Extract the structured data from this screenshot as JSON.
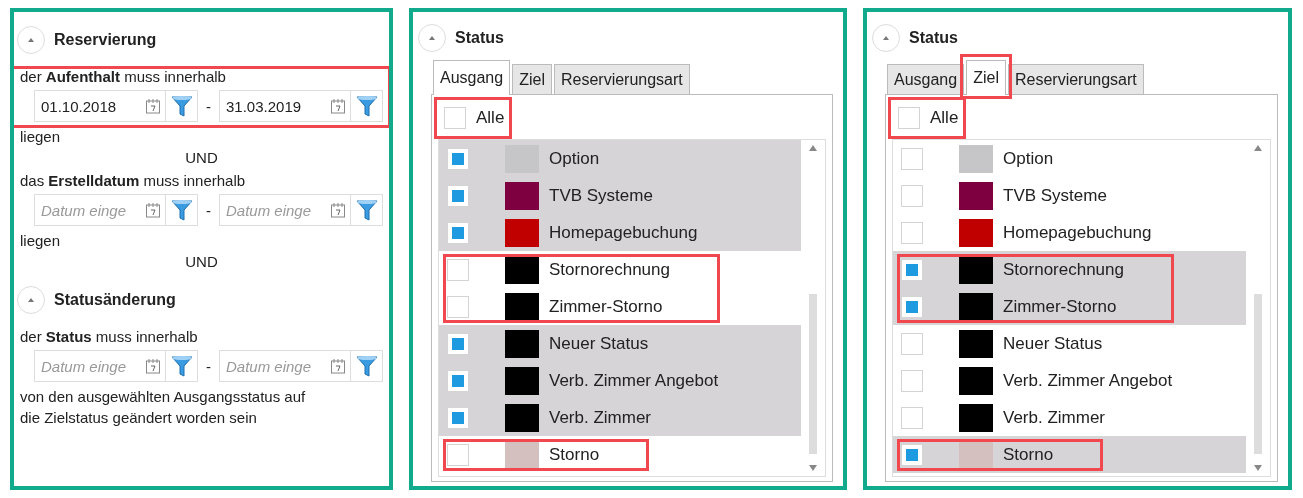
{
  "panels": [
    {
      "kind": "date_filters",
      "sections": [
        {
          "title": "Reservierung",
          "expanded": true,
          "blocks": [
            {
              "kind": "range",
              "label": "der **Aufenthalt** muss innerhalb",
              "from": {
                "value": "01.10.2018"
              },
              "separator": "-",
              "to": {
                "value": "31.03.2019"
              },
              "highlighted": true
            },
            {
              "kind": "text",
              "text": "liegen"
            },
            {
              "kind": "connector",
              "text": "UND"
            },
            {
              "kind": "range",
              "label": "das **Erstelldatum** muss innerhalb",
              "from": {
                "placeholder": "Datum einge"
              },
              "separator": "-",
              "to": {
                "placeholder": "Datum einge"
              },
              "highlighted": false
            },
            {
              "kind": "text",
              "text": "liegen"
            },
            {
              "kind": "connector",
              "text": "UND"
            }
          ]
        },
        {
          "title": "Statusänderung",
          "expanded": true,
          "blocks": [
            {
              "kind": "range",
              "label": "der **Status** muss innerhalb",
              "from": {
                "placeholder": "Datum einge"
              },
              "separator": "-",
              "to": {
                "placeholder": "Datum einge"
              },
              "highlighted": false
            },
            {
              "kind": "text",
              "text": "von den ausgewählten Ausgangsstatus auf die Zielstatus geändert worden sein"
            }
          ]
        }
      ]
    },
    {
      "kind": "status_list",
      "title": "Status",
      "expanded": true,
      "tabs": [
        {
          "label": "Ausgang",
          "selected": true,
          "highlighted": false
        },
        {
          "label": "Ziel",
          "selected": false,
          "highlighted": false
        },
        {
          "label": "Reservierungsart",
          "selected": false,
          "highlighted": false
        }
      ],
      "all": {
        "label": "Alle",
        "checked": false,
        "highlighted": true
      },
      "items": [
        {
          "label": "Option",
          "color": "#c6c6c8",
          "checked": true,
          "highlighted": false
        },
        {
          "label": "TVB Systeme",
          "color": "#7f0040",
          "checked": true,
          "highlighted": false
        },
        {
          "label": "Homepagebuchung",
          "color": "#c00000",
          "checked": true,
          "highlighted": false
        },
        {
          "label": "Stornorechnung",
          "color": "#000000",
          "checked": false,
          "highlighted": true
        },
        {
          "label": "Zimmer-Storno",
          "color": "#000000",
          "checked": false,
          "highlighted": true
        },
        {
          "label": "Neuer Status",
          "color": "#000000",
          "checked": true,
          "highlighted": false
        },
        {
          "label": "Verb. Zimmer Angebot",
          "color": "#000000",
          "checked": true,
          "highlighted": false
        },
        {
          "label": "Verb. Zimmer",
          "color": "#000000",
          "checked": true,
          "highlighted": false
        },
        {
          "label": "Storno",
          "color": "#d5c0c0",
          "checked": false,
          "highlighted": true
        }
      ]
    },
    {
      "kind": "status_list",
      "title": "Status",
      "expanded": true,
      "tabs": [
        {
          "label": "Ausgang",
          "selected": false,
          "highlighted": false
        },
        {
          "label": "Ziel",
          "selected": true,
          "highlighted": true
        },
        {
          "label": "Reservierungsart",
          "selected": false,
          "highlighted": false
        }
      ],
      "all": {
        "label": "Alle",
        "checked": false,
        "highlighted": true
      },
      "items": [
        {
          "label": "Option",
          "color": "#c6c6c8",
          "checked": false,
          "highlighted": false
        },
        {
          "label": "TVB Systeme",
          "color": "#7f0040",
          "checked": false,
          "highlighted": false
        },
        {
          "label": "Homepagebuchung",
          "color": "#c00000",
          "checked": false,
          "highlighted": false
        },
        {
          "label": "Stornorechnung",
          "color": "#000000",
          "checked": true,
          "highlighted": true
        },
        {
          "label": "Zimmer-Storno",
          "color": "#000000",
          "checked": true,
          "highlighted": true
        },
        {
          "label": "Neuer Status",
          "color": "#000000",
          "checked": false,
          "highlighted": false
        },
        {
          "label": "Verb. Zimmer Angebot",
          "color": "#000000",
          "checked": false,
          "highlighted": false
        },
        {
          "label": "Verb. Zimmer",
          "color": "#000000",
          "checked": false,
          "highlighted": false
        },
        {
          "label": "Storno",
          "color": "#d5c0c0",
          "checked": true,
          "highlighted": true
        }
      ]
    }
  ]
}
